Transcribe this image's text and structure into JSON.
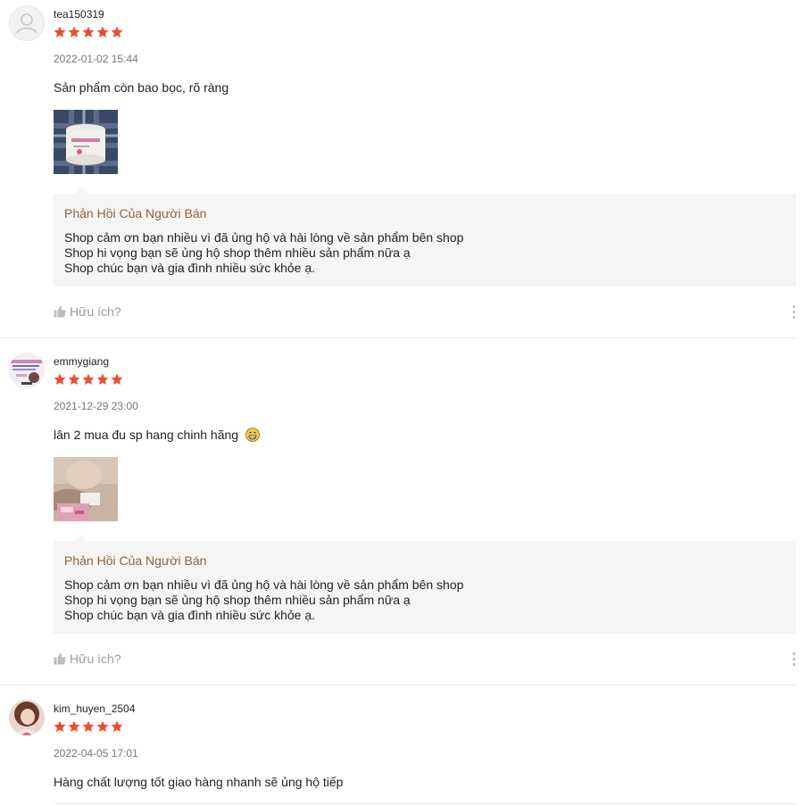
{
  "reviews": [
    {
      "username": "tea150319",
      "rating": 5,
      "timestamp": "2022-01-02 15:44",
      "comment": "Sản phẩm còn bao bọc, rõ ràng",
      "has_photo": true,
      "seller_reply": {
        "title": "Phản Hồi Của Người Bán",
        "lines": [
          "Shop cảm ơn bạn nhiều vì đã ủng hộ và hài lòng về sản phẩm bên shop",
          "Shop hi vọng bạn sẽ ủng hộ shop thêm nhiều sản phẩm nữa ạ",
          "Shop chúc bạn và gia đình nhiều sức khỏe ạ."
        ]
      },
      "helpful_label": "Hữu ích?"
    },
    {
      "username": "emmygiang",
      "rating": 5,
      "timestamp": "2021-12-29 23:00",
      "comment": "lân 2 mua đu sp hang chinh hãng",
      "comment_emoji": "grinning-face-emoji",
      "has_photo": true,
      "seller_reply": {
        "title": "Phản Hồi Của Người Bán",
        "lines": [
          "Shop cảm ơn bạn nhiều vì đã ủng hộ và hài lòng về sản phẩm bên shop",
          "Shop hi vọng bạn sẽ ủng hộ shop thêm nhiều sản phẩm nữa ạ",
          "Shop chúc bạn và gia đình nhiều sức khỏe ạ."
        ]
      },
      "helpful_label": "Hữu ích?"
    },
    {
      "username": "kim_huyen_2504",
      "rating": 5,
      "timestamp": "2022-04-05 17:01",
      "comment": "Hàng chất lượng tốt giao hàng nhanh sẽ ủng hộ tiếp"
    }
  ],
  "colors": {
    "star": "#ee4d2d",
    "reply_title": "#8a6340",
    "reply_bg": "#f5f5f5",
    "muted_text": "#767676"
  }
}
